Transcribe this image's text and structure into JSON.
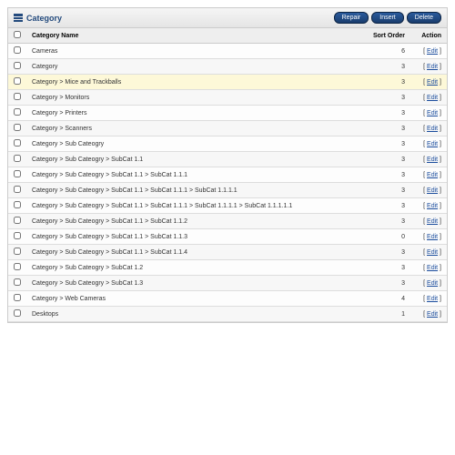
{
  "panel": {
    "title": "Category"
  },
  "buttons": {
    "repair": "Repair",
    "insert": "Insert",
    "delete": "Delete"
  },
  "columns": {
    "name": "Category Name",
    "sort": "Sort Order",
    "action": "Action"
  },
  "edit_label": "Edit",
  "rows": [
    {
      "name": "Cameras",
      "sort": "6",
      "hl": false
    },
    {
      "name": "Category",
      "sort": "3",
      "hl": false
    },
    {
      "name": "Category > Mice and Trackballs",
      "sort": "3",
      "hl": true
    },
    {
      "name": "Category > Monitors",
      "sort": "3",
      "hl": false
    },
    {
      "name": "Category > Printers",
      "sort": "3",
      "hl": false
    },
    {
      "name": "Category > Scanners",
      "sort": "3",
      "hl": false
    },
    {
      "name": "Category > Sub Cateogry",
      "sort": "3",
      "hl": false
    },
    {
      "name": "Category > Sub Cateogry > SubCat 1.1",
      "sort": "3",
      "hl": false
    },
    {
      "name": "Category > Sub Cateogry > SubCat 1.1 > SubCat 1.1.1",
      "sort": "3",
      "hl": false
    },
    {
      "name": "Category > Sub Cateogry > SubCat 1.1 > SubCat 1.1.1 > SubCat 1.1.1.1",
      "sort": "3",
      "hl": false
    },
    {
      "name": "Category > Sub Cateogry > SubCat 1.1 > SubCat 1.1.1 > SubCat 1.1.1.1 > SubCat 1.1.1.1.1",
      "sort": "3",
      "hl": false
    },
    {
      "name": "Category > Sub Cateogry > SubCat 1.1 > SubCat 1.1.2",
      "sort": "3",
      "hl": false
    },
    {
      "name": "Category > Sub Cateogry > SubCat 1.1 > SubCat 1.1.3",
      "sort": "0",
      "hl": false
    },
    {
      "name": "Category > Sub Cateogry > SubCat 1.1 > SubCat 1.1.4",
      "sort": "3",
      "hl": false
    },
    {
      "name": "Category > Sub Cateogry > SubCat 1.2",
      "sort": "3",
      "hl": false
    },
    {
      "name": "Category > Sub Cateogry > SubCat 1.3",
      "sort": "3",
      "hl": false
    },
    {
      "name": "Category > Web Cameras",
      "sort": "4",
      "hl": false
    },
    {
      "name": "Desktops",
      "sort": "1",
      "hl": false
    }
  ]
}
